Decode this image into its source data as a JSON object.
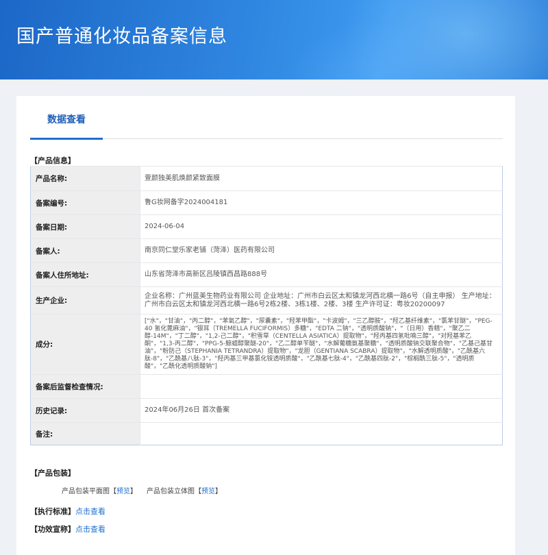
{
  "header": {
    "title": "国产普通化妆品备案信息"
  },
  "tabs": [
    {
      "label": "数据查看"
    }
  ],
  "product_info": {
    "section_title": "【产品信息】",
    "rows": [
      {
        "label": "产品名称:",
        "value": "萱颜独美肌焕颜紧致面膜"
      },
      {
        "label": "备案编号:",
        "value": "鲁G妆网备字2024004181"
      },
      {
        "label": "备案日期:",
        "value": "2024-06-04"
      },
      {
        "label": "备案人:",
        "value": "南京同仁堂乐家老铺（菏泽）医药有限公司"
      },
      {
        "label": "备案人住所地址:",
        "value": "山东省菏泽市高新区吕陵镇西昌路888号"
      },
      {
        "label": "生产企业:",
        "value": "企业名称：广州蓝美生物药业有限公司 企业地址：广州市白云区太和镇龙河西北横一路6号（自主申报） 生产地址：广州市白云区太和镇龙河西北横一路6号2栋2楼、3栋1楼、2楼、3楼 生产许可证：粤妆20200097"
      },
      {
        "label": "成分:",
        "value": "[\"水\"，\"甘油\"，\"丙二醇\"，\"苯氧乙醇\"，\"尿囊素\"，\"羟苯甲酯\"，\"卡波姆\"，\"三乙醇胺\"，\"羟乙基纤维素\"，\"氯苯甘醚\"，\"PEG-40 氢化蓖麻油\"，\"银耳（TREMELLA FUCIFORMIS）多糖\"，\"EDTA 二钠\"，\"透明质酸钠\"，\"（日用）香精\"，\"聚乙二醇-14M\"，\"丁二醇\"，\"1,2-己二醇\"，\"积雪草（CENTELLA ASIATICA）提取物\"，\"羟丙基四氢吡喃三醇\"，\"对羟基苯乙酮\"，\"1,3-丙二醇\"，\"PPG-5-鲸蜡醇聚醚-20\"，\"乙二醇单苄醚\"，\"水解葡糖氨基聚糖\"，\"透明质酸钠交联聚合物\"，\"乙基己基甘油\"，\"粉防己（STEPHANIA TETRANDRA）提取物\"，\"龙胆（GENTIANA SCABRA）提取物\"，\"水解透明质酸\"，\"乙酰基六肽-8\"，\"乙酰基八肽-3\"，\"羟丙基三甲基氯化铵透明质酸\"，\"乙酰基七肽-4\"，\"乙酰基四肽-2\"，\"棕榈酰三肽-5\"，\"透明质酸\"，\"乙酰化透明质酸钠\"]"
      },
      {
        "label": "备案后监督检查情况:",
        "value": ""
      },
      {
        "label": "历史记录:",
        "value": "2024年06月26日 首次备案"
      },
      {
        "label": "备注:",
        "value": ""
      }
    ]
  },
  "packaging": {
    "section_title": "【产品包装】",
    "flat_label": "产品包装平面图",
    "solid_label": "产品包装立体图",
    "bracket_open": "【",
    "bracket_close": "】",
    "preview_label": "预览"
  },
  "standard": {
    "label": "【执行标准】",
    "link": "点击查看"
  },
  "efficacy": {
    "label": "【功效宣称】",
    "link": "点击查看"
  }
}
